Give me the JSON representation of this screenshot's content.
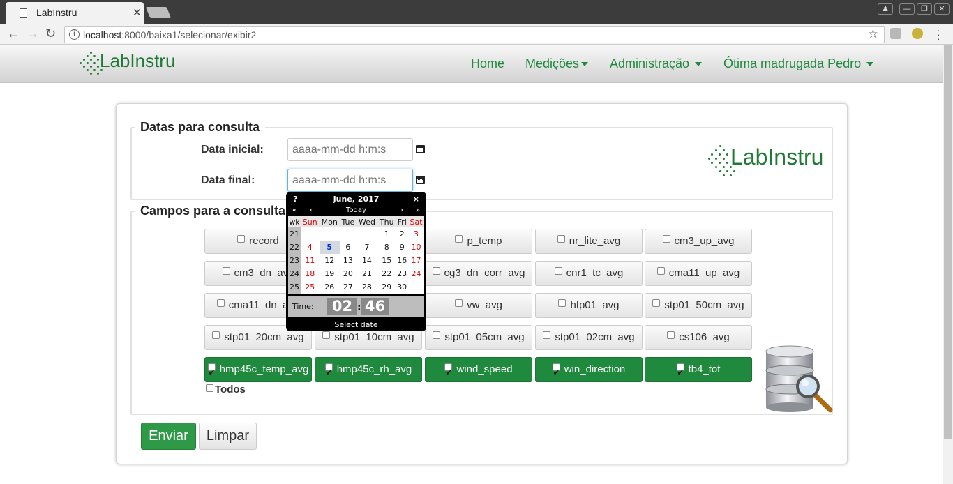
{
  "browser": {
    "tab_title": "LabInstru",
    "url_host": "localhost",
    "url_rest": ":8000/baixa1/selecionar/exibir2"
  },
  "site": {
    "logo_text": "LabInstru",
    "nav": {
      "home": "Home",
      "medicoes": "Medições",
      "administracao": "Administração",
      "user": "Ótima madrugada Pedro"
    }
  },
  "dates": {
    "legend": "Datas para consulta",
    "start_label": "Data inicial:",
    "end_label": "Data final:",
    "start_placeholder": "aaaa-mm-dd h:m:s",
    "end_placeholder": "aaaa-mm-dd h:m:s"
  },
  "fields": {
    "legend": "Campos para a consulta",
    "items": [
      {
        "label": "record",
        "checked": false
      },
      {
        "label": "p_temp",
        "checked": false
      },
      {
        "label": "nr_lite_avg",
        "checked": false
      },
      {
        "label": "cm3_up_avg",
        "checked": false
      },
      {
        "label": "cm3_dn_avg",
        "checked": false
      },
      {
        "label": "cg3_dn_corr_avg",
        "checked": false
      },
      {
        "label": "cnr1_tc_avg",
        "checked": false
      },
      {
        "label": "cma11_up_avg",
        "checked": false
      },
      {
        "label": "cma11_dn_avg",
        "checked": false
      },
      {
        "label": "vw_avg",
        "checked": false
      },
      {
        "label": "hfp01_avg",
        "checked": false
      },
      {
        "label": "stp01_50cm_avg",
        "checked": false
      },
      {
        "label": "stp01_20cm_avg",
        "checked": false
      },
      {
        "label": "stp01_10cm_avg",
        "checked": false
      },
      {
        "label": "stp01_05cm_avg",
        "checked": false
      },
      {
        "label": "stp01_02cm_avg",
        "checked": false
      },
      {
        "label": "cs106_avg",
        "checked": false
      },
      {
        "label": "hmp45c_temp_avg",
        "checked": true
      },
      {
        "label": "hmp45c_rh_avg",
        "checked": true
      },
      {
        "label": "wind_speed",
        "checked": true
      },
      {
        "label": "win_direction",
        "checked": true
      },
      {
        "label": "tb4_tot",
        "checked": true
      }
    ],
    "todos_label": "Todos"
  },
  "buttons": {
    "submit": "Enviar",
    "clear": "Limpar"
  },
  "calendar": {
    "help": "?",
    "month_title": "June, 2017",
    "close": "×",
    "prev_year": "«",
    "prev_month": "‹",
    "today": "Today",
    "next_month": "›",
    "next_year": "»",
    "headers": [
      "wk",
      "Sun",
      "Mon",
      "Tue",
      "Wed",
      "Thu",
      "Fri",
      "Sat"
    ],
    "weeks": [
      [
        "21",
        "",
        "",
        "",
        "",
        "1",
        "2",
        "3"
      ],
      [
        "22",
        "4",
        "5",
        "6",
        "7",
        "8",
        "9",
        "10"
      ],
      [
        "23",
        "11",
        "12",
        "13",
        "14",
        "15",
        "16",
        "17"
      ],
      [
        "24",
        "18",
        "19",
        "20",
        "21",
        "22",
        "23",
        "24"
      ],
      [
        "25",
        "25",
        "26",
        "27",
        "28",
        "29",
        "30",
        ""
      ]
    ],
    "selected_day": "5",
    "time_label": "Time:",
    "hour": "02",
    "minute": "46",
    "footer": "Select date"
  }
}
